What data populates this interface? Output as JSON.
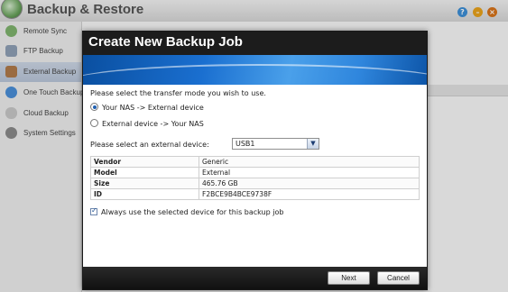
{
  "app": {
    "title": "Backup & Restore",
    "help_label": "?",
    "minimize_label": "–",
    "close_label": "×"
  },
  "sidebar": {
    "items": [
      {
        "label": "Remote Sync",
        "icon": "sync-icon",
        "color": "#7fb36e"
      },
      {
        "label": "FTP Backup",
        "icon": "ftp-icon",
        "color": "#8fa0b5"
      },
      {
        "label": "External Backup",
        "icon": "external-drive-icon",
        "color": "#b07a4a",
        "active": true
      },
      {
        "label": "One Touch Backup",
        "icon": "one-touch-icon",
        "color": "#4a8fd8"
      },
      {
        "label": "Cloud Backup",
        "icon": "cloud-icon",
        "color": "#c8c8c8"
      },
      {
        "label": "System Settings",
        "icon": "gear-icon",
        "color": "#8a8a8a"
      }
    ]
  },
  "dialog": {
    "title": "Create New Backup Job",
    "prompt": "Please select the transfer mode you wish to use.",
    "mode_options": [
      {
        "label": "Your NAS -> External device",
        "selected": true
      },
      {
        "label": "External device -> Your NAS",
        "selected": false
      }
    ],
    "device_label": "Please select an external device:",
    "device_selected": "USB1",
    "device_info": [
      {
        "key": "Vendor",
        "value": "Generic"
      },
      {
        "key": "Model",
        "value": "External"
      },
      {
        "key": "Size",
        "value": "465.76 GB"
      },
      {
        "key": "ID",
        "value": "F2BCE9B4BCE9738F"
      }
    ],
    "always_use_label": "Always use the selected device for this backup job",
    "always_use_checked": true,
    "next_label": "Next",
    "cancel_label": "Cancel"
  }
}
